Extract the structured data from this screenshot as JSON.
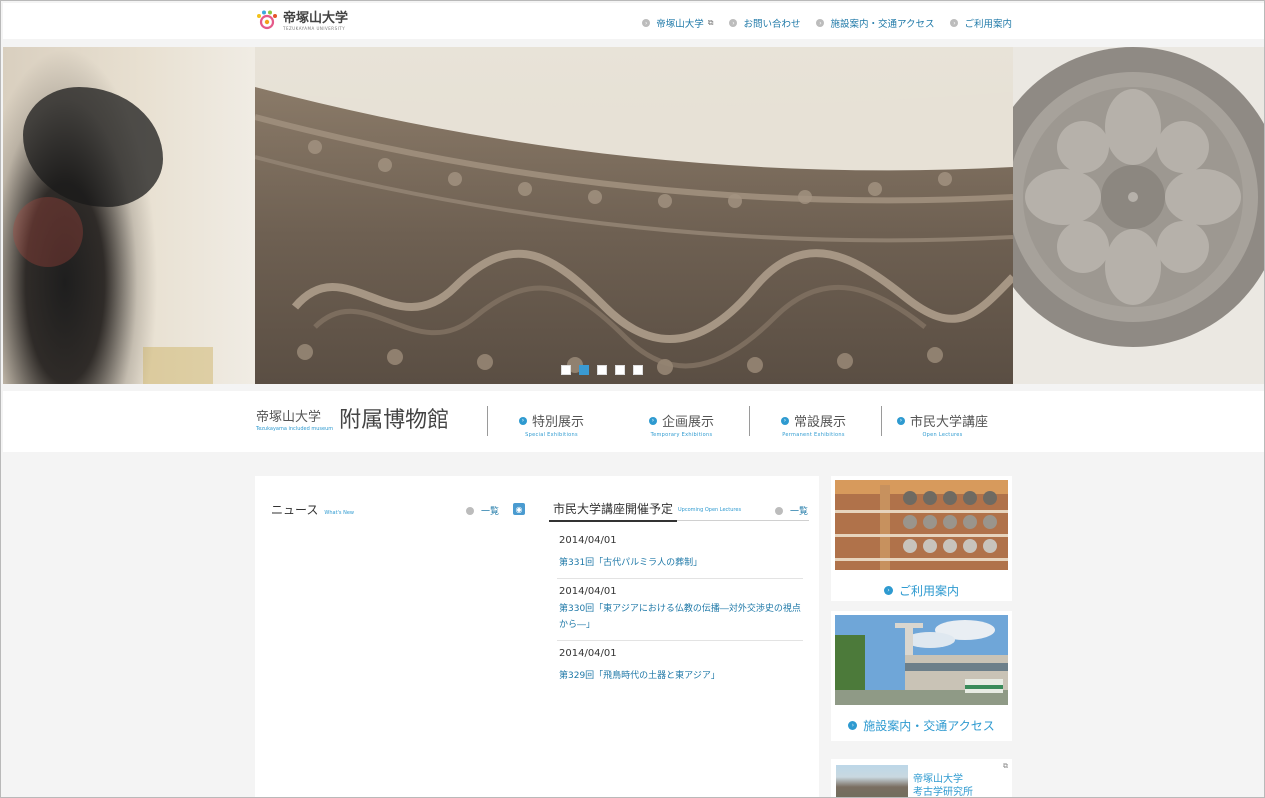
{
  "header": {
    "logo_text": "帝塚山大学",
    "logo_sub": "TEZUKAYAMA UNIVERSITY",
    "links": [
      {
        "label": "帝塚山大学",
        "external": "⧉"
      },
      {
        "label": "お問い合わせ"
      },
      {
        "label": "施設案内・交通アクセス"
      },
      {
        "label": "ご利用案内"
      }
    ]
  },
  "slider": {
    "dots": 5,
    "active_index": 1
  },
  "museum_nav": {
    "title_uni": "帝塚山大学",
    "title_en": "Tezukayama included museum",
    "title_big": "附属博物館",
    "items": [
      {
        "jp": "特別展示",
        "en": "Special Exhibitions"
      },
      {
        "jp": "企画展示",
        "en": "Temporary Exhibitions"
      },
      {
        "jp": "常設展示",
        "en": "Permanent Exhibitions"
      },
      {
        "jp": "市民大学講座",
        "en": "Open Lectures"
      }
    ]
  },
  "news": {
    "title": "ニュース",
    "title_en": "What's New",
    "more_label": "一覧"
  },
  "lectures": {
    "title": "市民大学講座開催予定",
    "title_en": "Upcoming Open Lectures",
    "more_label": "一覧",
    "items": [
      {
        "date": "2014/04/01",
        "title": "第331回「古代パルミラ人の葬制」"
      },
      {
        "date": "2014/04/01",
        "title": "第330回「東アジアにおける仏教の伝播―対外交渉史の視点から―」"
      },
      {
        "date": "2014/04/01",
        "title": "第329回「飛鳥時代の土器と東アジア」"
      }
    ]
  },
  "sidebar": {
    "guide_label": "ご利用案内",
    "access_label": "施設案内・交通アクセス",
    "institute_line1": "帝塚山大学",
    "institute_line2": "考古学研究所"
  },
  "colors": {
    "accent": "#2e9ad0",
    "link": "#1f79a8",
    "page_bg": "#f4f4f4"
  }
}
